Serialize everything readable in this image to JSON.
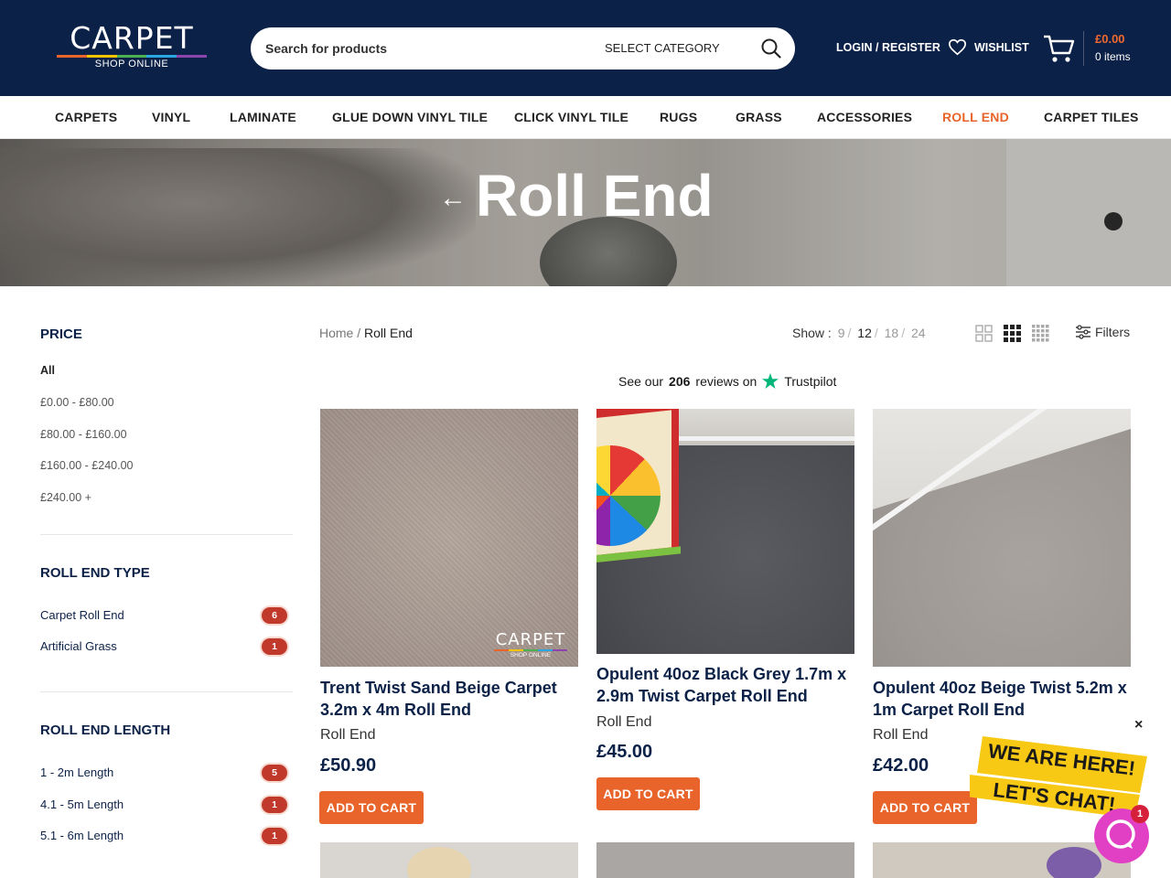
{
  "header": {
    "logo_main": "CARPET",
    "logo_sub": "SHOP ONLINE",
    "search_placeholder": "Search for products",
    "search_category": "SELECT CATEGORY",
    "login_label": "LOGIN / REGISTER",
    "wishlist_label": "WISHLIST",
    "cart_total": "£0.00",
    "cart_items": "0 items",
    "colors": {
      "navy": "#0c2147",
      "accent": "#e8642b"
    }
  },
  "nav": {
    "items": [
      {
        "label": "CARPETS"
      },
      {
        "label": "VINYL"
      },
      {
        "label": "LAMINATE"
      },
      {
        "label": "GLUE DOWN VINYL TILE"
      },
      {
        "label": "CLICK VINYL TILE"
      },
      {
        "label": "RUGS"
      },
      {
        "label": "GRASS"
      },
      {
        "label": "ACCESSORIES"
      },
      {
        "label": "ROLL END",
        "active": true
      },
      {
        "label": "CARPET TILES"
      }
    ]
  },
  "hero": {
    "title": "Roll End",
    "back_icon": "←"
  },
  "sidebar": {
    "price": {
      "title": "PRICE",
      "options": [
        "All",
        "£0.00 - £80.00",
        "£80.00 - £160.00",
        "£160.00 - £240.00",
        "£240.00 +"
      ]
    },
    "roll_end_type": {
      "title": "ROLL END TYPE",
      "items": [
        {
          "label": "Carpet Roll End",
          "count": "6"
        },
        {
          "label": "Artificial Grass",
          "count": "1"
        }
      ]
    },
    "roll_end_length": {
      "title": "ROLL END LENGTH",
      "items": [
        {
          "label": "1 - 2m Length",
          "count": "5"
        },
        {
          "label": "4.1 - 5m Length",
          "count": "1"
        },
        {
          "label": "5.1 - 6m Length",
          "count": "1"
        }
      ]
    }
  },
  "toolbar": {
    "breadcrumb_home": "Home",
    "breadcrumb_sep": "/",
    "breadcrumb_current": "Roll End",
    "show_label": "Show :",
    "show_options": [
      "9",
      "12",
      "18",
      "24"
    ],
    "show_selected": "12",
    "filters_label": "Filters"
  },
  "trustpilot": {
    "prefix": "See our",
    "count": "206",
    "suffix": "reviews on",
    "brand": "Trustpilot"
  },
  "products": [
    {
      "title": "Trent Twist Sand Beige Carpet 3.2m x 4m Roll End",
      "category": "Roll End",
      "price": "£50.90",
      "button": "ADD TO CART",
      "watermark": "CARPET",
      "watermark_sub": "SHOP ONLINE"
    },
    {
      "title": "Opulent 40oz Black Grey 1.7m x 2.9m Twist Carpet Roll End",
      "category": "Roll End",
      "price": "£45.00",
      "button": "ADD TO CART"
    },
    {
      "title": "Opulent 40oz Beige Twist 5.2m x 1m Carpet Roll End",
      "category": "Roll End",
      "price": "£42.00",
      "button": "ADD TO CART"
    }
  ],
  "chat": {
    "close": "×",
    "line1": "WE ARE HERE!",
    "line2": "LET'S CHAT!",
    "badge": "1"
  }
}
